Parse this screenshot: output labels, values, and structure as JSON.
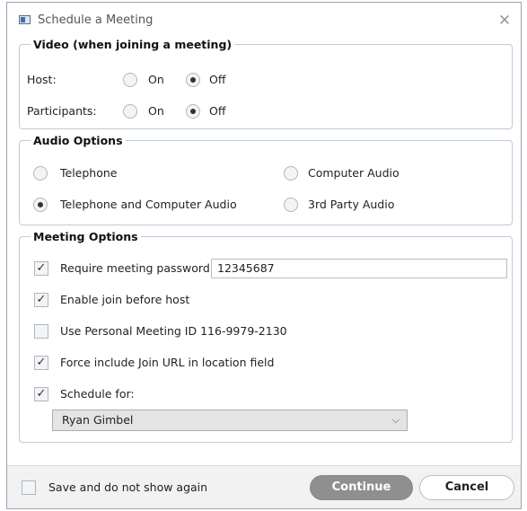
{
  "window": {
    "title": "Schedule a Meeting",
    "close_glyph": "✕"
  },
  "video": {
    "legend": "Video (when joining a meeting)",
    "host_label": "Host:",
    "participants_label": "Participants:",
    "on_label": "On",
    "off_label": "Off",
    "host_value": "Off",
    "participants_value": "Off"
  },
  "audio": {
    "legend": "Audio Options",
    "options": [
      "Telephone",
      "Computer Audio",
      "Telephone and Computer Audio",
      "3rd Party Audio"
    ],
    "selected": "Telephone and Computer Audio"
  },
  "meeting": {
    "legend": "Meeting Options",
    "require_password_label": "Require meeting password",
    "require_password_checked": true,
    "password_value": "12345687",
    "join_before_host_label": "Enable join before host",
    "join_before_host_checked": true,
    "personal_id_label": "Use Personal Meeting ID 116-9979-2130",
    "personal_id_checked": false,
    "force_join_url_label": "Force include Join URL in location field",
    "force_join_url_checked": true,
    "schedule_for_label": "Schedule for:",
    "schedule_for_checked": true,
    "schedule_for_value": "Ryan Gimbel"
  },
  "footer": {
    "dont_show_label": "Save and do not show again",
    "dont_show_checked": false,
    "continue_label": "Continue",
    "cancel_label": "Cancel"
  },
  "icons": {
    "check_glyph": "✓",
    "chevron_glyph": "⌵"
  }
}
